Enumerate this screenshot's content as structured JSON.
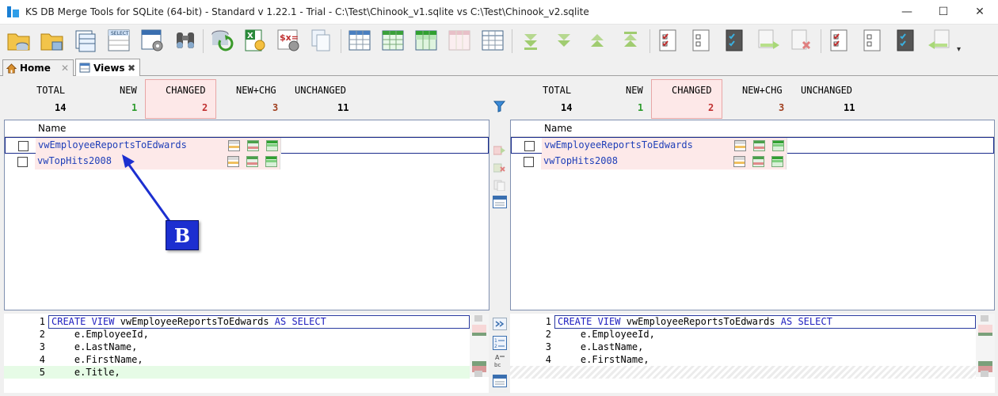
{
  "window": {
    "title": "KS DB Merge Tools for SQLite (64-bit) - Standard v 1.22.1 - Trial - C:\\Test\\Chinook_v1.sqlite vs C:\\Test\\Chinook_v2.sqlite",
    "minimize": "—",
    "maximize": "☐",
    "close": "✕"
  },
  "toolbar": {
    "more_glyph": "▾"
  },
  "tabs": [
    {
      "label": "Home",
      "close": "✕"
    },
    {
      "label": "Views",
      "close": "✖"
    }
  ],
  "stats_headers": [
    "TOTAL",
    "NEW",
    "CHANGED",
    "NEW+CHG",
    "UNCHANGED"
  ],
  "left": {
    "stats": {
      "total": "14",
      "new": "1",
      "changed": "2",
      "new_chg": "3",
      "unchanged": "11"
    },
    "column_header": "Name",
    "rows": [
      {
        "name": "vwEmployeeReportsToEdwards",
        "checked": false
      },
      {
        "name": "vwTopHits2008",
        "checked": false
      }
    ],
    "code": [
      {
        "num": "1",
        "kw1": "CREATE VIEW",
        "mid": " vwEmployeeReportsToEdwards ",
        "kw2": "AS SELECT"
      },
      {
        "num": "2",
        "text": "    e.EmployeeId,"
      },
      {
        "num": "3",
        "text": "    e.LastName,"
      },
      {
        "num": "4",
        "text": "    e.FirstName,"
      },
      {
        "num": "5",
        "text": "    e.Title,"
      }
    ]
  },
  "right": {
    "stats": {
      "total": "14",
      "new": "1",
      "changed": "2",
      "new_chg": "3",
      "unchanged": "11"
    },
    "column_header": "Name",
    "rows": [
      {
        "name": "vwEmployeeReportsToEdwards",
        "checked": false
      },
      {
        "name": "vwTopHits2008",
        "checked": false
      }
    ],
    "code": [
      {
        "num": "1",
        "kw1": "CREATE VIEW",
        "mid": " vwEmployeeReportsToEdwards ",
        "kw2": "AS SELECT"
      },
      {
        "num": "2",
        "text": "    e.EmployeeId,"
      },
      {
        "num": "3",
        "text": "    e.LastName,"
      },
      {
        "num": "4",
        "text": "    e.FirstName,"
      }
    ]
  },
  "annotation": {
    "label": "B"
  },
  "colors": {
    "new": "#2a9a2a",
    "changed": "#c03030",
    "new_chg": "#a04020",
    "link": "#1f3fb8",
    "keyword": "#2020c0",
    "changed_bg": "#fde9e9",
    "added_line_bg": "#e6fbe6"
  }
}
